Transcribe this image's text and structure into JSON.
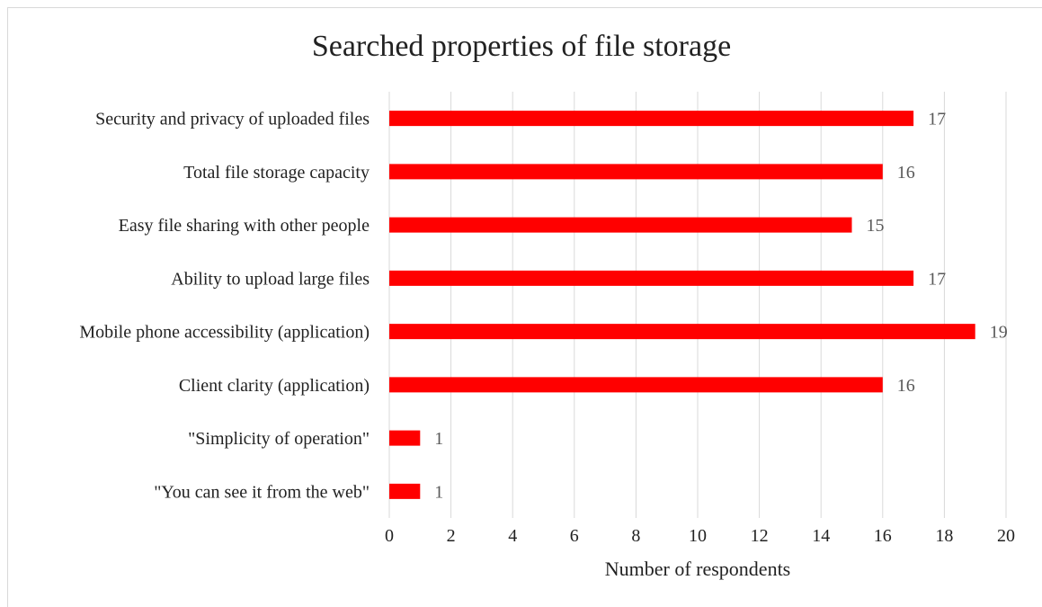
{
  "chart_data": {
    "type": "bar",
    "orientation": "horizontal",
    "title": "Searched properties of file storage",
    "xlabel": "Number of respondents",
    "ylabel": "",
    "xlim": [
      0,
      20
    ],
    "xticks": [
      0,
      2,
      4,
      6,
      8,
      10,
      12,
      14,
      16,
      18,
      20
    ],
    "grid": "vertical",
    "legend": "none",
    "bar_color": "#ff0000",
    "categories": [
      "Security and privacy of uploaded files",
      "Total file storage capacity",
      "Easy file sharing with other people",
      "Ability to upload large files",
      "Mobile phone accessibility (application)",
      "Client clarity (application)",
      "\"Simplicity of operation\"",
      "\"You can see it from the web\""
    ],
    "values": [
      17,
      16,
      15,
      17,
      19,
      16,
      1,
      1
    ]
  }
}
